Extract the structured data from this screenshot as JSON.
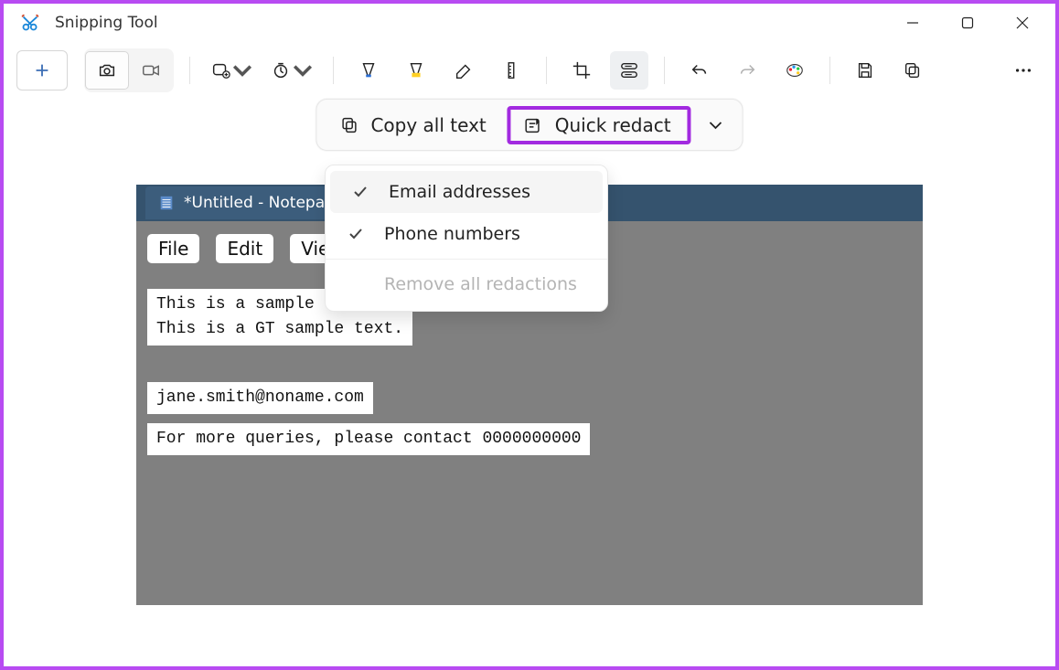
{
  "window": {
    "title": "Snipping Tool"
  },
  "text_actions": {
    "copy_all": "Copy all text",
    "quick_redact": "Quick redact"
  },
  "redact_menu": {
    "emails": "Email addresses",
    "phones": "Phone numbers",
    "remove_all": "Remove all redactions"
  },
  "notepad": {
    "tab_title": "*Untitled - Notepad",
    "menus": [
      "File",
      "Edit",
      "View"
    ],
    "line1": "This is a sample text.",
    "line2": "This is a GT sample text.",
    "email": "jane.smith@noname.com",
    "contact_line": "For more queries, please contact 0000000000"
  }
}
